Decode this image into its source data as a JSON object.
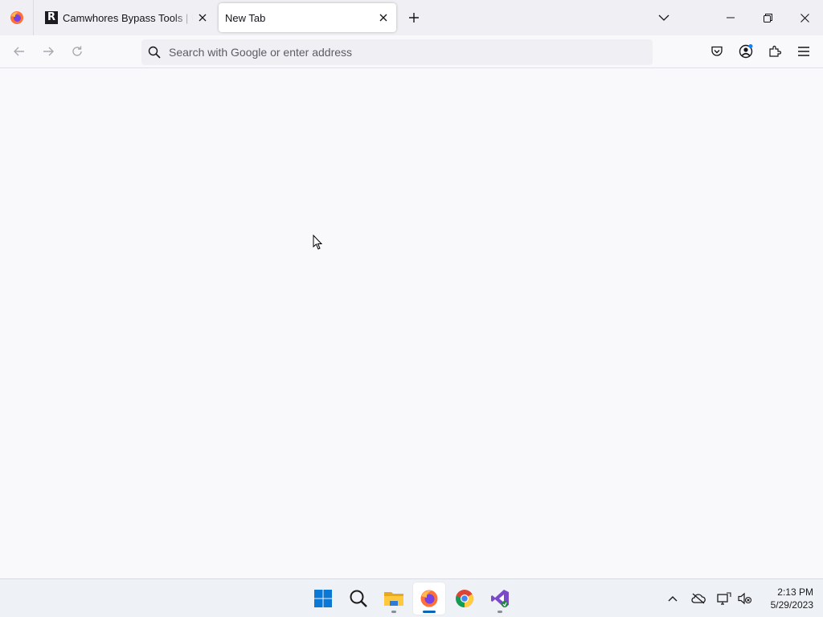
{
  "browser": {
    "tabs": [
      {
        "title": "Camwhores Bypass Tools | Priva",
        "favicon": "R",
        "active": false
      },
      {
        "title": "New Tab",
        "active": true
      }
    ],
    "urlbar": {
      "placeholder": "Search with Google or enter address",
      "value": ""
    }
  },
  "taskbar": {
    "clock": {
      "time": "2:13 PM",
      "date": "5/29/2023"
    },
    "apps": [
      "start",
      "search",
      "file-explorer",
      "firefox",
      "chrome",
      "visual-studio"
    ]
  },
  "colors": {
    "accent": "#0a66b8",
    "toolbar": "#f0f0f4",
    "page": "#f9f9fb"
  }
}
